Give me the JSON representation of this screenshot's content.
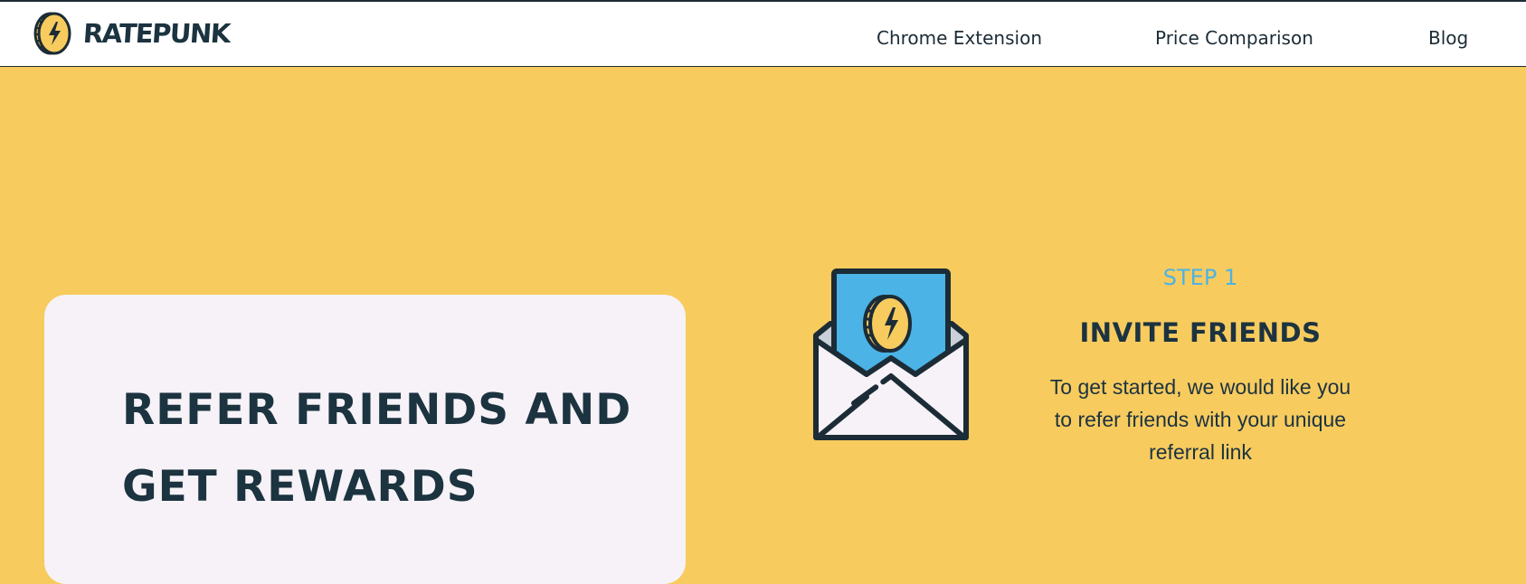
{
  "header": {
    "logo_text": "RATEPUNK",
    "logo_icon": "lightning-coin-icon",
    "nav": [
      {
        "label": "Chrome Extension"
      },
      {
        "label": "Price Comparison"
      },
      {
        "label": "Blog"
      }
    ]
  },
  "hero": {
    "title": "REFER FRIENDS AND GET REWARDS"
  },
  "step": {
    "label": "STEP 1",
    "title": "INVITE FRIENDS",
    "description": "To get started, we would like you to refer friends with your unique referral link",
    "illustration": "envelope-with-coin-icon"
  },
  "colors": {
    "background": "#F7CB5E",
    "card": "#F6F2F7",
    "accent_blue": "#4BB3E6",
    "dark": "#1C3340"
  }
}
